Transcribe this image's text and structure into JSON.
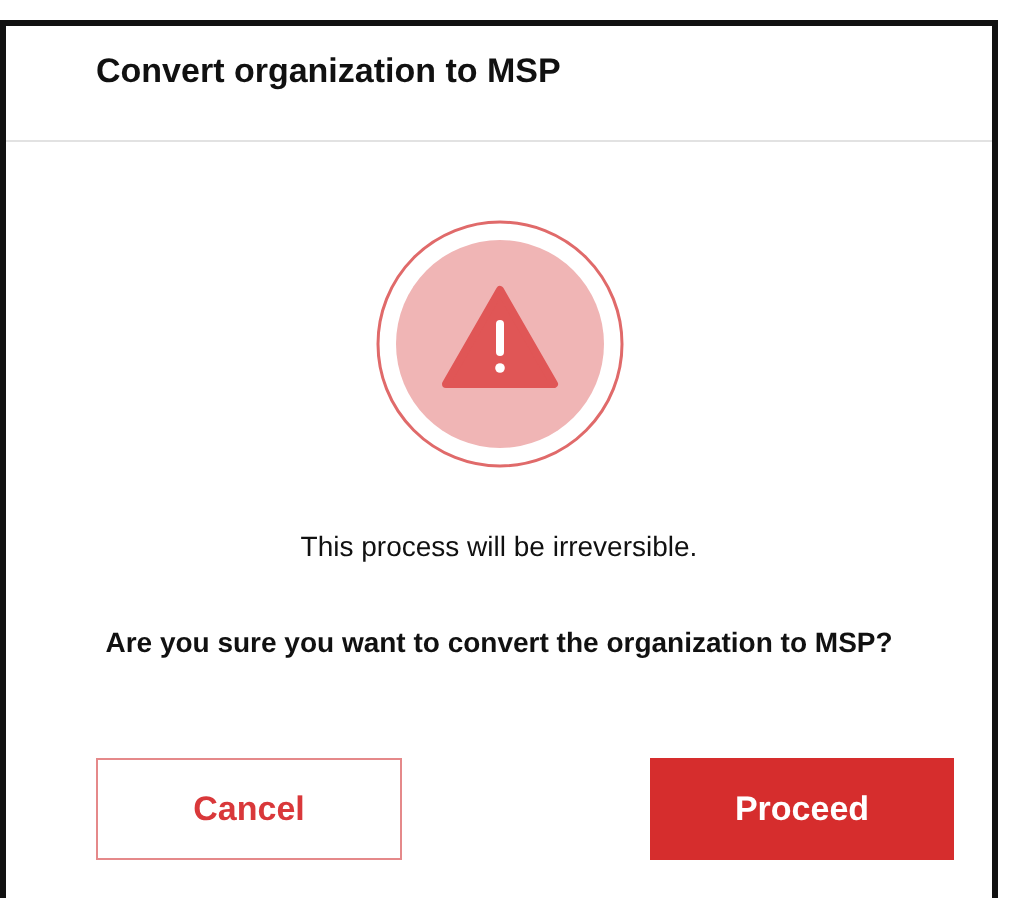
{
  "dialog": {
    "title": "Convert organization to MSP",
    "message": "This process will be irreversible.",
    "question": "Are you sure you want to convert the organization to MSP?",
    "buttons": [
      {
        "label": "Cancel",
        "kind": "secondary"
      },
      {
        "label": "Proceed",
        "kind": "primary"
      }
    ]
  }
}
